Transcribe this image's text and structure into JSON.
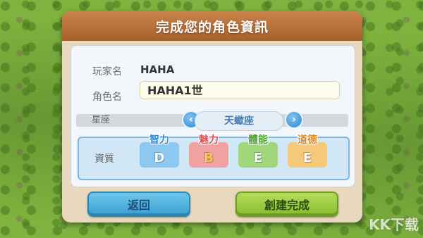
{
  "dialog": {
    "title": "完成您的角色資訊"
  },
  "form": {
    "player_label": "玩家名",
    "player_value": "HAHA",
    "character_label": "角色名",
    "character_value": "HAHA1世",
    "zodiac_label": "星座",
    "zodiac_value": "天蠍座",
    "prev_icon": "chevron-left-icon",
    "next_icon": "chevron-right-icon"
  },
  "aptitude": {
    "label": "資質",
    "stats": [
      {
        "name": "智力",
        "grade": "D",
        "name_color": "#2f86cf",
        "card_color": "#8cc8f0"
      },
      {
        "name": "魅力",
        "grade": "B",
        "name_color": "#e04c4c",
        "card_color": "#f2a1a1"
      },
      {
        "name": "體能",
        "grade": "E",
        "name_color": "#4aa02c",
        "card_color": "#9fd77a"
      },
      {
        "name": "道德",
        "grade": "E",
        "name_color": "#e08a1c",
        "card_color": "#f5c97a"
      }
    ]
  },
  "buttons": {
    "back": "返回",
    "create": "創建完成"
  },
  "watermark": "KK下载"
}
